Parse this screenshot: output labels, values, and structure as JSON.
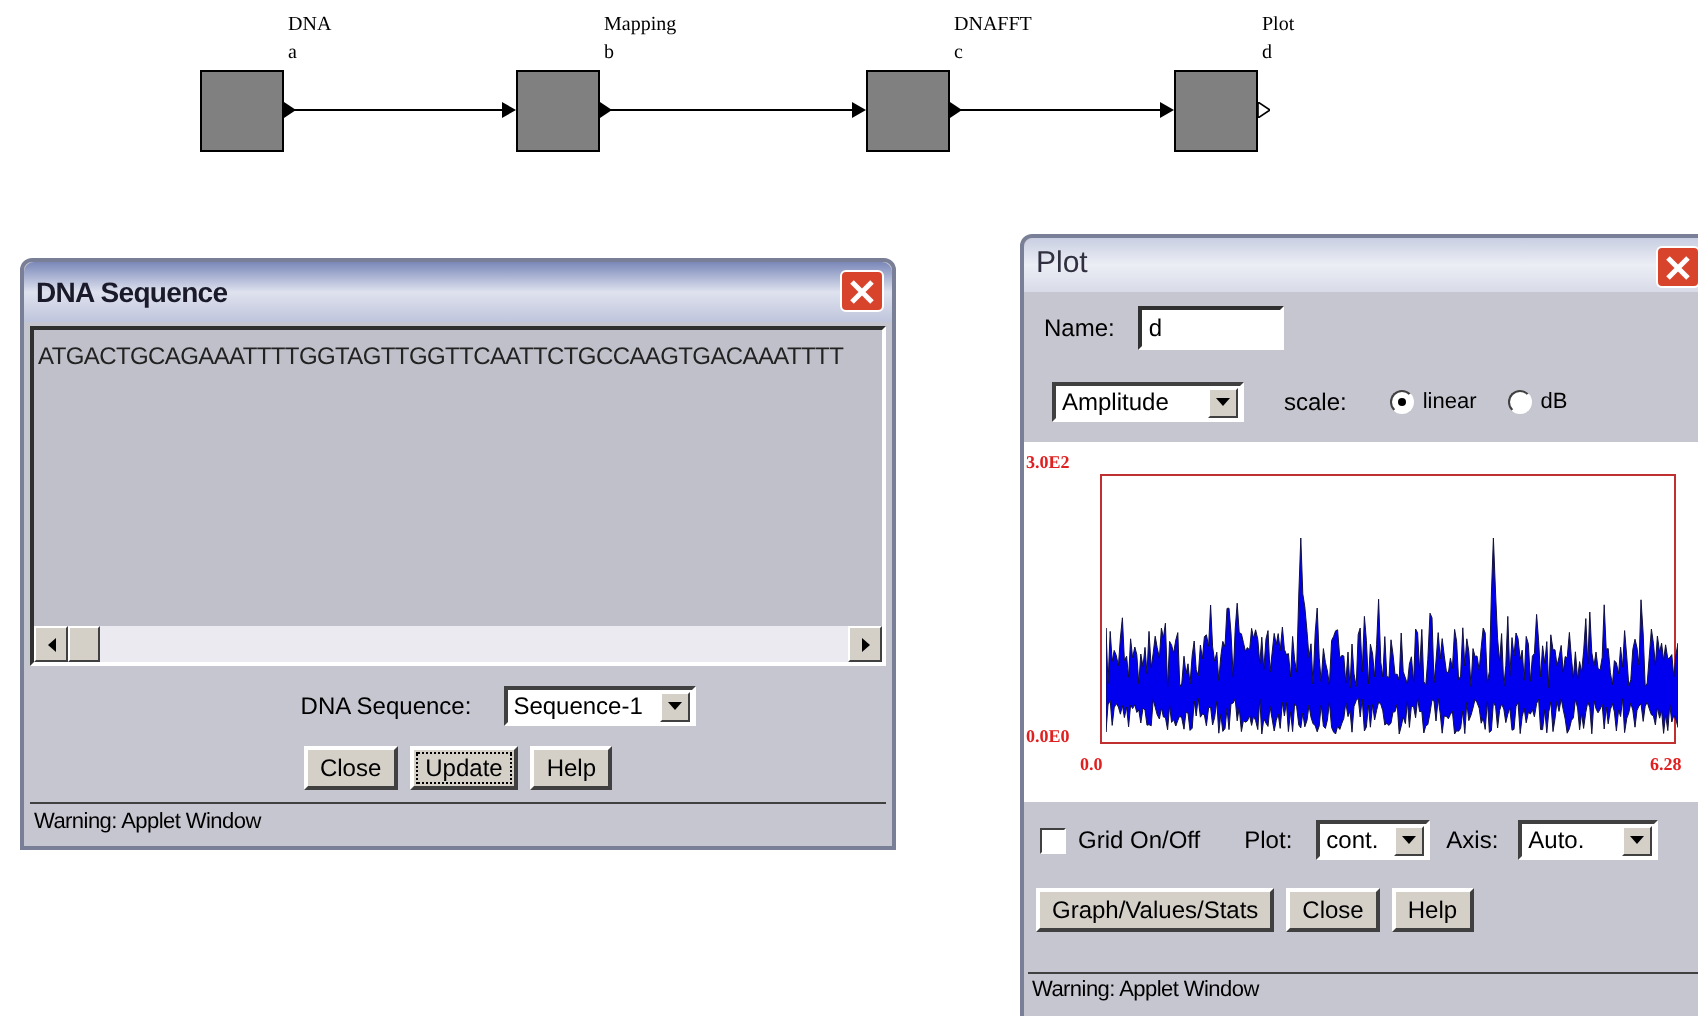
{
  "diagram": {
    "nodes": [
      {
        "name": "DNA",
        "letter": "a"
      },
      {
        "name": "Mapping",
        "letter": "b"
      },
      {
        "name": "DNAFFT",
        "letter": "c"
      },
      {
        "name": "Plot",
        "letter": "d"
      }
    ]
  },
  "dna_window": {
    "title": "DNA Sequence",
    "sequence": "ATGACTGCAGAAATTTTGGTAGTTGGTTCAATTCTGCCAAGTGACAAATTTT",
    "selector_label": "DNA Sequence:",
    "selector_value": "Sequence-1",
    "buttons": [
      {
        "label": "Close",
        "focused": false
      },
      {
        "label": "Update",
        "focused": true
      },
      {
        "label": "Help",
        "focused": false
      }
    ],
    "status": "Warning: Applet Window"
  },
  "plot_window": {
    "title": "Plot",
    "name_label": "Name:",
    "name_value": "d",
    "mode_value": "Amplitude",
    "scale_label": "scale:",
    "scale_options": [
      {
        "label": "linear",
        "selected": true
      },
      {
        "label": "dB",
        "selected": false
      }
    ],
    "chart": {
      "y_max": "3.0E2",
      "y_min": "0.0E0",
      "x_min": "0.0",
      "x_max": "6.28"
    },
    "grid": {
      "label": "Grid On/Off",
      "checked": false
    },
    "plot_label": "Plot:",
    "plot_value": "cont.",
    "axis_label": "Axis:",
    "axis_value": "Auto.",
    "buttons": [
      {
        "label": "Graph/Values/Stats",
        "focused": false
      },
      {
        "label": "Close",
        "focused": false
      },
      {
        "label": "Help",
        "focused": false
      }
    ],
    "status": "Warning: Applet Window"
  }
}
